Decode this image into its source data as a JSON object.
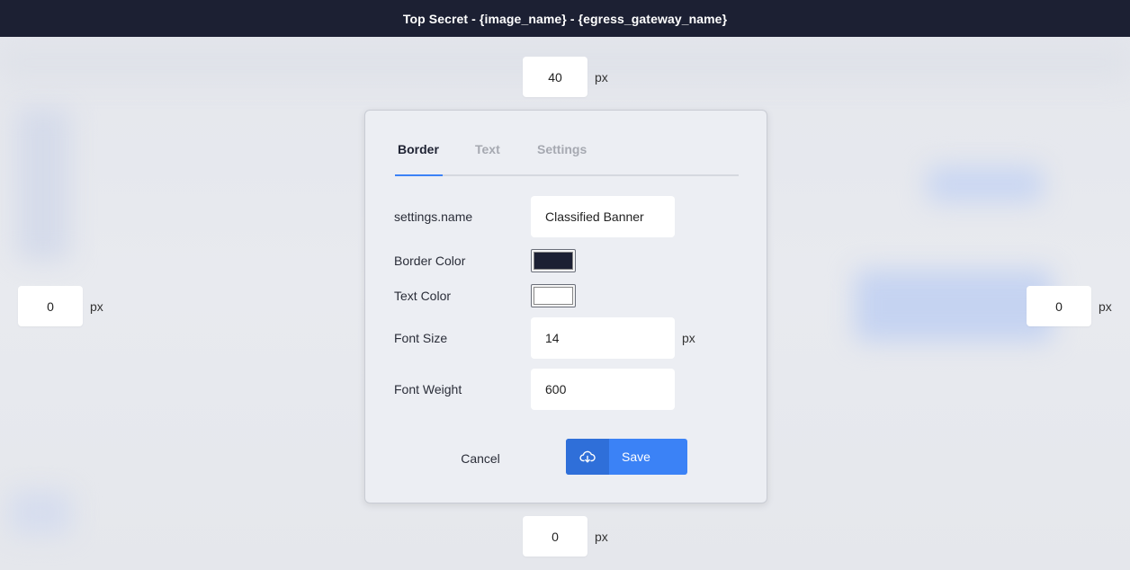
{
  "banner": {
    "text": "Top Secret - {image_name} - {egress_gateway_name}"
  },
  "margins": {
    "top": {
      "value": "40",
      "unit": "px"
    },
    "left": {
      "value": "0",
      "unit": "px"
    },
    "right": {
      "value": "0",
      "unit": "px"
    },
    "bottom": {
      "value": "0",
      "unit": "px"
    }
  },
  "dialog": {
    "tabs": [
      {
        "label": "Border",
        "active": true
      },
      {
        "label": "Text",
        "active": false
      },
      {
        "label": "Settings",
        "active": false
      }
    ],
    "fields": {
      "name": {
        "label": "settings.name",
        "value": "Classified Banner"
      },
      "border_color": {
        "label": "Border Color",
        "color": "#1c2033"
      },
      "text_color": {
        "label": "Text Color",
        "color": "#ffffff"
      },
      "font_size": {
        "label": "Font Size",
        "value": "14",
        "unit": "px"
      },
      "font_weight": {
        "label": "Font Weight",
        "value": "600"
      }
    },
    "cancel_label": "Cancel",
    "save_label": "Save",
    "save_icon": "cloud-download-icon"
  },
  "colors": {
    "accent": "#3b82f6",
    "banner_bg": "#1c2033"
  }
}
